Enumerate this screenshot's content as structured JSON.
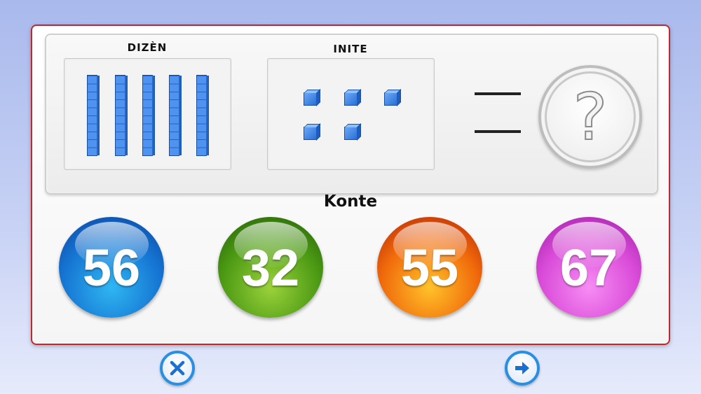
{
  "panel": {
    "tens_label": "DIZÈN",
    "ones_label": "INITE",
    "tens_count": 5,
    "ones_count": 5,
    "answer_placeholder": "?"
  },
  "prompt": "Konte",
  "choices": [
    "56",
    "32",
    "55",
    "67"
  ],
  "choice_colors": [
    "#1676d3",
    "#4c9a14",
    "#f06a0b",
    "#d94bd8"
  ],
  "footer": {
    "close_icon": "close-icon",
    "next_icon": "arrow-right-icon"
  }
}
